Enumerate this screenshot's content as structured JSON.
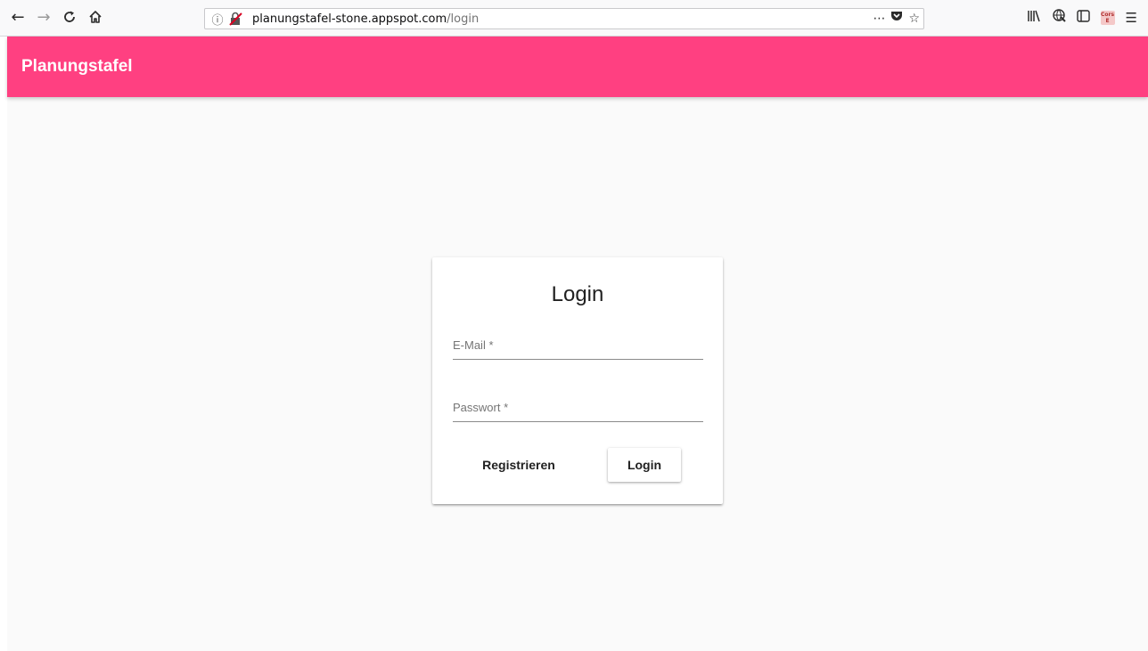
{
  "browser": {
    "url_host": "planungstafel-stone.appspot.com",
    "url_path": "/login",
    "icons": {
      "back": "arrow-left-icon",
      "forward": "arrow-right-icon",
      "reload": "reload-icon",
      "home": "home-icon",
      "page_actions": "more-icon",
      "pocket": "pocket-icon",
      "bookmark": "star-icon",
      "library": "library-icon",
      "extension": "extension-icon",
      "sidebar": "sidebar-icon",
      "menu": "hamburger-menu-icon"
    },
    "cors_badge_line1": "Cors",
    "cors_badge_line2": "E"
  },
  "app": {
    "title": "Planungstafel",
    "accent_color": "#ff4081"
  },
  "login": {
    "title": "Login",
    "email_label": "E-Mail *",
    "email_value": "",
    "password_label": "Passwort *",
    "password_value": "",
    "register_button": "Registrieren",
    "login_button": "Login"
  }
}
